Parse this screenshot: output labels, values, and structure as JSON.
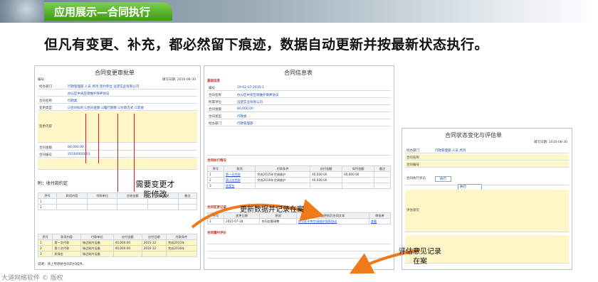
{
  "header": {
    "title": "应用展示—合同执行"
  },
  "subtitle": "但凡有变更、补充，都必然留下痕迹，数据自动更新并按最新状态执行。",
  "panel_left": {
    "title": "合同变更审批单",
    "code_label": "编号:",
    "fill_date": "填写日期: 2016-08-30",
    "rows": [
      {
        "label": "经办部门",
        "value": "行政管理部   人员  周鸿   签约单位  远望实业有限公司"
      },
      {
        "label": "",
        "value": "办公区中央空调维护保养协议"
      },
      {
        "label": "合同名称",
        "value": "行政类"
      },
      {
        "label": "变更类型",
        "value": "☑合同标的 ☑合同金额 ☑履行期限 ☑付款方式 ☑其他"
      },
      {
        "label": "变更内容",
        "value": ""
      },
      {
        "label": "合同金额",
        "value": "80,000.00"
      },
      {
        "label": "合同编号",
        "value": "20160000001"
      }
    ],
    "sub_title": "附：收付款约定",
    "notes": "说明：请上传原始合同的扫描件。"
  },
  "panel_mid": {
    "title": "合同信息表",
    "section_basic": "基础信息",
    "rows": [
      {
        "label": "编号",
        "value": "19-02-07-2015-1"
      },
      {
        "label": "合同名称",
        "value": "办公区中央空调维护保养协议"
      },
      {
        "label": "所属单位",
        "value": "远望实业有限公司"
      },
      {
        "label": "合同金额",
        "value": "80,000.00"
      },
      {
        "label": "合同类型",
        "value": "行政类"
      },
      {
        "label": "经办部门",
        "value": "行政管理部"
      }
    ],
    "section_pay": "合同执行情况",
    "pay_headers": [
      "序号",
      "款项",
      "付款条件",
      "应付金额",
      "实付金额",
      "备注"
    ],
    "pay_rows": [
      [
        "1",
        "第一次付款",
        "完成2015年空调维护",
        "40,000.00",
        "40,000.00",
        ""
      ],
      [
        "2",
        "第二次付款",
        "完成2016年空调维护",
        "40,000.00",
        "",
        ""
      ],
      [
        "3",
        "质保金",
        "",
        "",
        "",
        ""
      ]
    ],
    "section_change": "合同变更记录",
    "section_eval": "合同履约评价"
  },
  "panel_right": {
    "title": "合同状态变化与评估单",
    "fill_date": "填写日期: 2016-08-30",
    "rows": [
      {
        "label": "经办部门",
        "value": "行政管理部   人员  周鸿"
      },
      {
        "label": "合同名称",
        "value": ""
      },
      {
        "label": "合同编号",
        "value": ""
      },
      {
        "label": "合同执行状态",
        "value": "执行"
      },
      {
        "label": "评估意见",
        "value": ""
      }
    ],
    "dropdown_options": [
      "执行",
      "中止",
      "终止",
      "完成",
      "解除"
    ]
  },
  "callouts": {
    "change_note": "需要变更才\n能修改",
    "update_note": "更新数据并记录在案",
    "eval_note": "评估意见记录\n在案"
  },
  "footer": "大道网络软件 © 版权"
}
